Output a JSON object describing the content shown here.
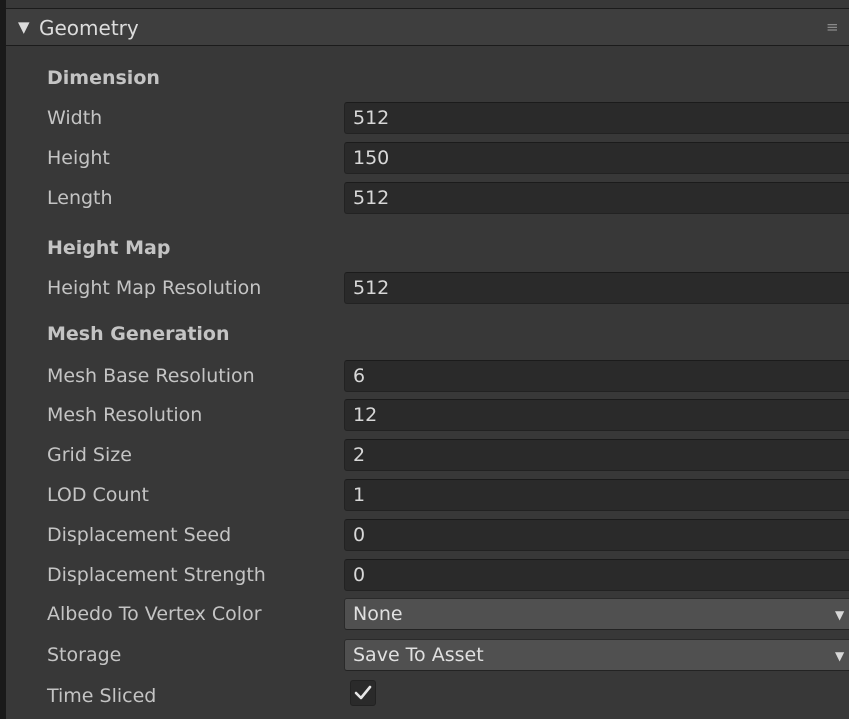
{
  "header": {
    "fold_glyph": "▼",
    "title": "Geometry",
    "menu_glyph": "≡"
  },
  "sections": {
    "dimension": "Dimension",
    "height_map": "Height Map",
    "mesh_generation": "Mesh Generation"
  },
  "fields": {
    "width": {
      "label": "Width",
      "value": "512"
    },
    "height": {
      "label": "Height",
      "value": "150"
    },
    "length": {
      "label": "Length",
      "value": "512"
    },
    "height_map_resolution": {
      "label": "Height Map Resolution",
      "value": "512"
    },
    "mesh_base_resolution": {
      "label": "Mesh Base Resolution",
      "value": "6"
    },
    "mesh_resolution": {
      "label": "Mesh Resolution",
      "value": "12"
    },
    "grid_size": {
      "label": "Grid Size",
      "value": "2"
    },
    "lod_count": {
      "label": "LOD Count",
      "value": "1"
    },
    "displacement_seed": {
      "label": "Displacement Seed",
      "value": "0"
    },
    "displacement_strength": {
      "label": "Displacement Strength",
      "value": "0"
    },
    "albedo_to_vertex_color": {
      "label": "Albedo To Vertex Color",
      "value": "None"
    },
    "storage": {
      "label": "Storage",
      "value": "Save To Asset"
    },
    "time_sliced": {
      "label": "Time Sliced",
      "checked": true
    }
  },
  "icons": {
    "foldout": "triangle-down-icon",
    "menu": "hamburger-menu-icon",
    "dropdown": "dropdown-arrow-icon",
    "check": "checkmark-icon"
  },
  "colors": {
    "background": "#383838",
    "header": "#3e3e3e",
    "field": "#2a2a2a",
    "dropdown": "#505050",
    "text": "#c4c4c4"
  }
}
